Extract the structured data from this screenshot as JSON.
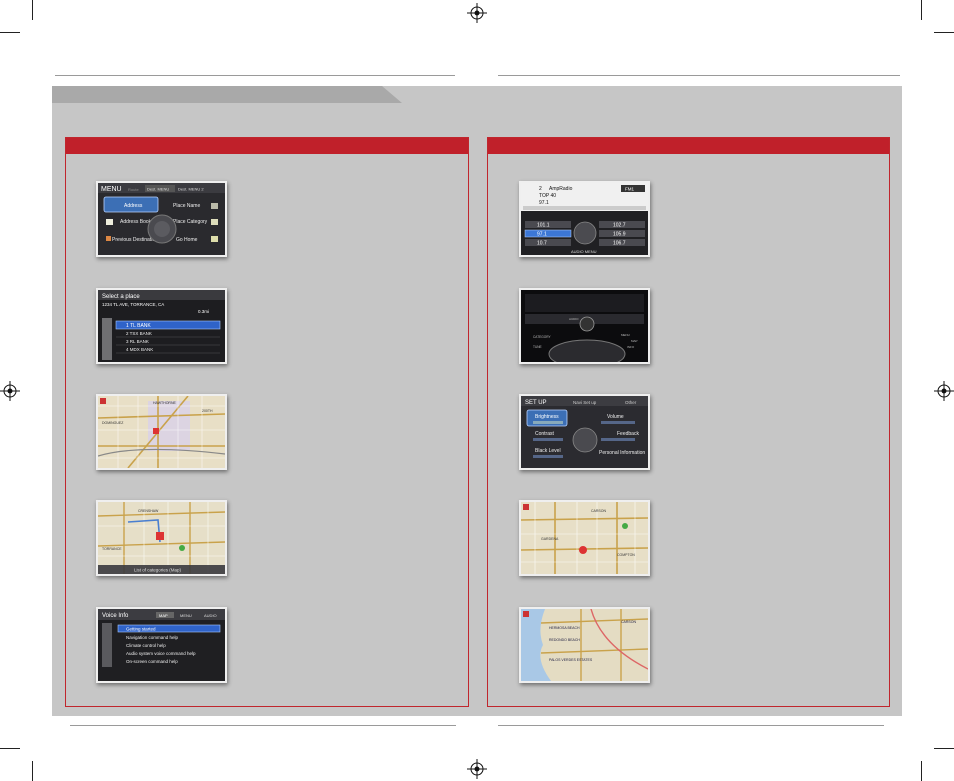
{
  "page": {
    "background": "#ffffff",
    "band_color": "#c6c6c6",
    "accent": "#c0202a"
  },
  "left_panel": {
    "screens": [
      {
        "id": "menu",
        "title": "MENU",
        "tabs": [
          "Route",
          "Dest. MENU",
          "Dest. MENU 2"
        ],
        "items": [
          "Address",
          "Place Name",
          "Address Book",
          "Place Category",
          "Previous Destinations",
          "Go Home"
        ]
      },
      {
        "id": "select-place",
        "title": "Select a place",
        "address": "1234 TL AVE, TORRANCE, CA",
        "distance": "0.3mi",
        "items": [
          "1 TL BANK",
          "2 TSX BANK",
          "3 RL BANK",
          "4 MDX BANK"
        ]
      },
      {
        "id": "map-1",
        "labels": [
          "HAWTHORNE",
          "DOMINGUEZ",
          "200TH"
        ]
      },
      {
        "id": "map-2",
        "labels": [
          "CRENSHAW",
          "TORRANCE"
        ],
        "footer": "List of categories (Map)"
      },
      {
        "id": "voice-info",
        "title": "Voice Info",
        "tabs": [
          "MAP",
          "MENU",
          "AUDIO"
        ],
        "items": [
          "Getting started",
          "Navigation command help",
          "Climate control help",
          "Audio system voice command help",
          "On-screen command help"
        ]
      }
    ]
  },
  "right_panel": {
    "screens": [
      {
        "id": "audio",
        "channel": "2",
        "station_name": "AmpRadio",
        "program": "TOP 40",
        "freq": "97.1",
        "band": "FM1",
        "presets": [
          "101.1",
          "102.7",
          "97.1",
          "105.9",
          "10.7",
          "106.7"
        ],
        "footer": "AUDIO MENU"
      },
      {
        "id": "console",
        "labels": [
          "CATEGORY",
          "TUNE",
          "AUDIO",
          "MENU",
          "MAP",
          "INFO"
        ]
      },
      {
        "id": "setup",
        "title": "SET UP",
        "tabs": [
          "Navi Set up",
          "Other"
        ],
        "items": [
          "Brightness",
          "Volume",
          "Contrast",
          "Feedback",
          "Black Level",
          "Personal Information"
        ]
      },
      {
        "id": "map-3",
        "labels": [
          "CARSON",
          "GARDENA",
          "COMPTON"
        ]
      },
      {
        "id": "map-4",
        "labels": [
          "HERMOSA BEACH",
          "REDONDO BEACH",
          "PALOS VERDES ESTATES",
          "CARSON"
        ]
      }
    ]
  }
}
